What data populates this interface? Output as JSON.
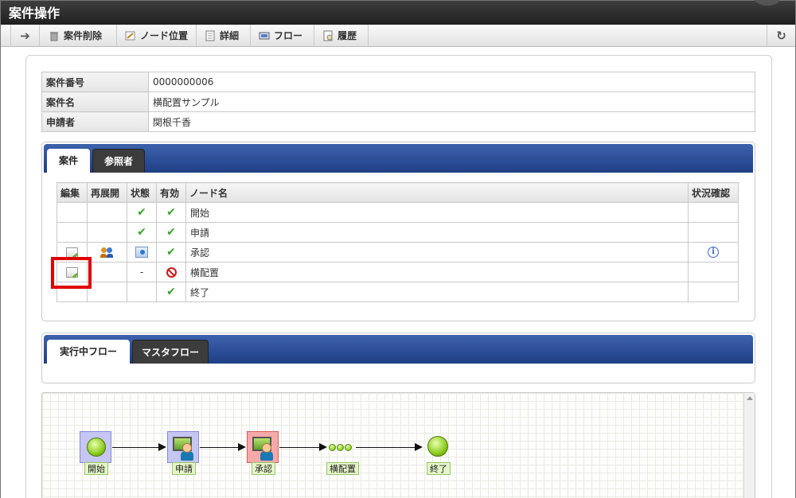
{
  "window": {
    "title": "案件操作"
  },
  "toolbar": {
    "back_icon": "arrow-left-icon",
    "refresh_icon": "refresh-icon",
    "buttons": [
      {
        "label": "案件削除",
        "icon": "trash-icon"
      },
      {
        "label": "ノード位置",
        "icon": "node-position-icon"
      },
      {
        "label": "詳細",
        "icon": "document-icon"
      },
      {
        "label": "フロー",
        "icon": "flow-icon"
      },
      {
        "label": "履歴",
        "icon": "history-icon"
      }
    ]
  },
  "info": {
    "rows": [
      {
        "label": "案件番号",
        "value": "0000000006"
      },
      {
        "label": "案件名",
        "value": "横配置サンプル"
      },
      {
        "label": "申請者",
        "value": "関根千香"
      }
    ]
  },
  "case_tabs": {
    "tabs": [
      {
        "label": "案件",
        "active": true
      },
      {
        "label": "参照者",
        "active": false
      }
    ]
  },
  "node_table": {
    "headers": [
      "編集",
      "再展開",
      "状態",
      "有効",
      "ノード名",
      "状況確認"
    ],
    "rows": [
      {
        "edit": "",
        "reopen": "",
        "state": "check",
        "valid": "check",
        "name": "開始",
        "status": ""
      },
      {
        "edit": "",
        "reopen": "",
        "state": "check",
        "valid": "check",
        "name": "申請",
        "status": ""
      },
      {
        "edit": "edit",
        "reopen": "users",
        "state": "processing",
        "valid": "check",
        "name": "承認",
        "status": "info"
      },
      {
        "edit": "edit",
        "reopen": "",
        "state": "-",
        "valid": "disabled",
        "name": "横配置",
        "status": ""
      },
      {
        "edit": "",
        "reopen": "",
        "state": "",
        "valid": "check",
        "name": "終了",
        "status": ""
      }
    ]
  },
  "flow_tabs": {
    "tabs": [
      {
        "label": "実行中フロー",
        "active": true
      },
      {
        "label": "マスタフロー",
        "active": false
      }
    ]
  },
  "flow": {
    "nodes": [
      {
        "label": "開始",
        "kind": "start"
      },
      {
        "label": "申請",
        "kind": "user"
      },
      {
        "label": "承認",
        "kind": "active-user"
      },
      {
        "label": "横配置",
        "kind": "horizontal"
      },
      {
        "label": "終了",
        "kind": "end"
      }
    ]
  },
  "colors": {
    "tab_bar": "#2a4f9c",
    "highlight": "#e00000",
    "check": "#3aa52a",
    "disabled": "#d01818"
  }
}
